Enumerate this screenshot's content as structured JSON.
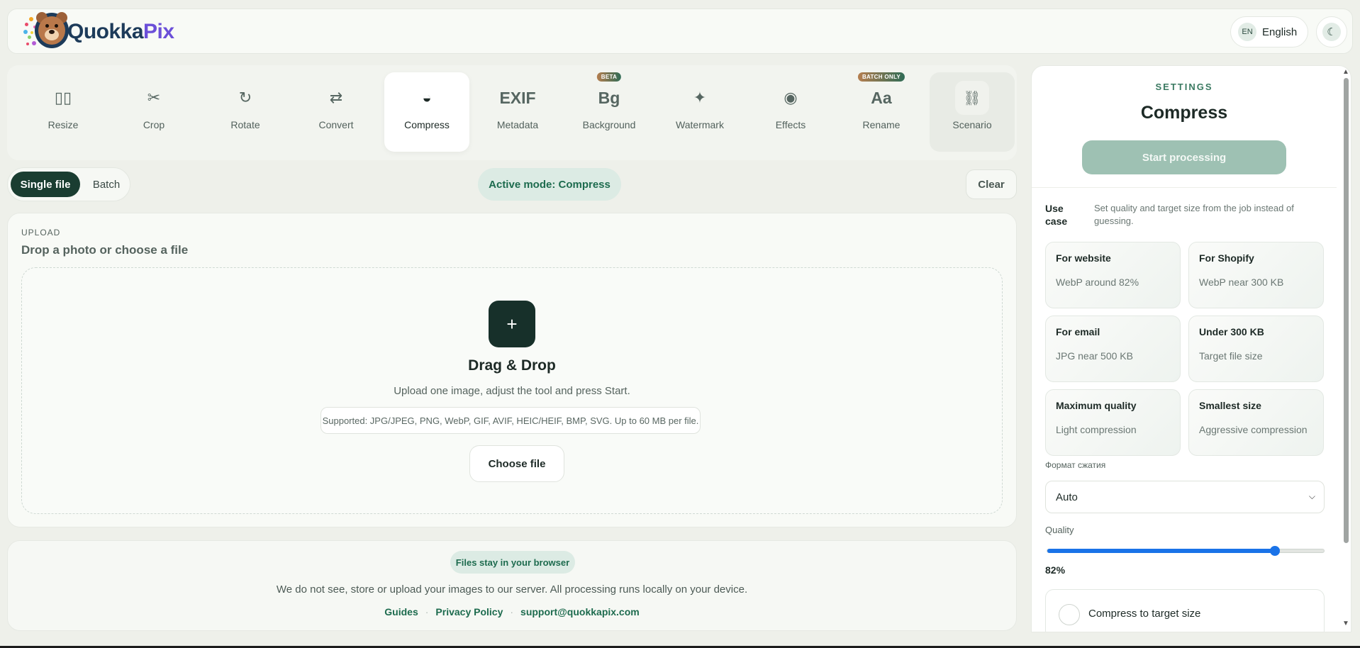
{
  "header": {
    "logo_text_part1": "Quokka",
    "logo_text_part2": "Pix",
    "lang_code": "EN",
    "lang_name": "English",
    "theme_icon": "☾"
  },
  "tools": [
    {
      "label": "Resize",
      "icon": "▯▯",
      "icon_name": "resize-icon"
    },
    {
      "label": "Crop",
      "icon": "✂",
      "icon_name": "scissors-icon"
    },
    {
      "label": "Rotate",
      "icon": "↻",
      "icon_name": "rotate-icon"
    },
    {
      "label": "Convert",
      "icon": "⇄",
      "icon_name": "convert-arrows-icon"
    },
    {
      "label": "Compress",
      "icon": "◒",
      "icon_name": "compress-icon"
    },
    {
      "label": "Metadata",
      "icon": "EXIF",
      "icon_name": "exif-icon"
    },
    {
      "label": "Background",
      "icon": "Bg",
      "icon_name": "background-icon",
      "badge": "BETA"
    },
    {
      "label": "Watermark",
      "icon": "✦",
      "icon_name": "sparkle-icon"
    },
    {
      "label": "Effects",
      "icon": "◉",
      "icon_name": "effects-icon"
    },
    {
      "label": "Rename",
      "icon": "Aa",
      "icon_name": "rename-icon",
      "badge": "BATCH ONLY"
    },
    {
      "label": "Scenario",
      "icon": "⛓",
      "icon_name": "chain-icon"
    }
  ],
  "mode": {
    "single": "Single file",
    "batch": "Batch",
    "active_mode": "Active mode: Compress",
    "clear": "Clear"
  },
  "upload": {
    "eyebrow": "UPLOAD",
    "title": "Drop a photo or choose a file",
    "plus": "+",
    "drag_title": "Drag & Drop",
    "drag_sub": "Upload one image, adjust the tool and press Start.",
    "supported": "Supported: JPG/JPEG, PNG, WebP, GIF, AVIF, HEIC/HEIF, BMP, SVG. Up to 60 MB per file.",
    "choose": "Choose file"
  },
  "privacy": {
    "pill": "Files stay in your browser",
    "text": "We do not see, store or upload your images to our server. All processing runs locally on your device.",
    "links": [
      "Guides",
      "Privacy Policy",
      "support@quokkapix.com"
    ],
    "separator": "·"
  },
  "settings": {
    "eyebrow": "SETTINGS",
    "title": "Compress",
    "start": "Start processing",
    "use_case_label": "Use case",
    "use_case_desc": "Set quality and target size from the job instead of guessing.",
    "cards": [
      {
        "title": "For website",
        "desc": "WebP around 82%"
      },
      {
        "title": "For Shopify",
        "desc": "WebP near 300 KB"
      },
      {
        "title": "For email",
        "desc": "JPG near 500 KB"
      },
      {
        "title": "Under 300 KB",
        "desc": "Target file size"
      },
      {
        "title": "Maximum quality",
        "desc": "Light compression"
      },
      {
        "title": "Smallest size",
        "desc": "Aggressive compression"
      }
    ],
    "format_label": "Формат сжатия",
    "format_value": "Auto",
    "quality_label": "Quality",
    "quality_value": "82%",
    "quality_fraction": 0.82,
    "target_size_label": "Compress to target size"
  },
  "colors": {
    "accent": "#1a3d31",
    "accent_soft": "#dcebe4",
    "slider": "#1a73e8"
  }
}
